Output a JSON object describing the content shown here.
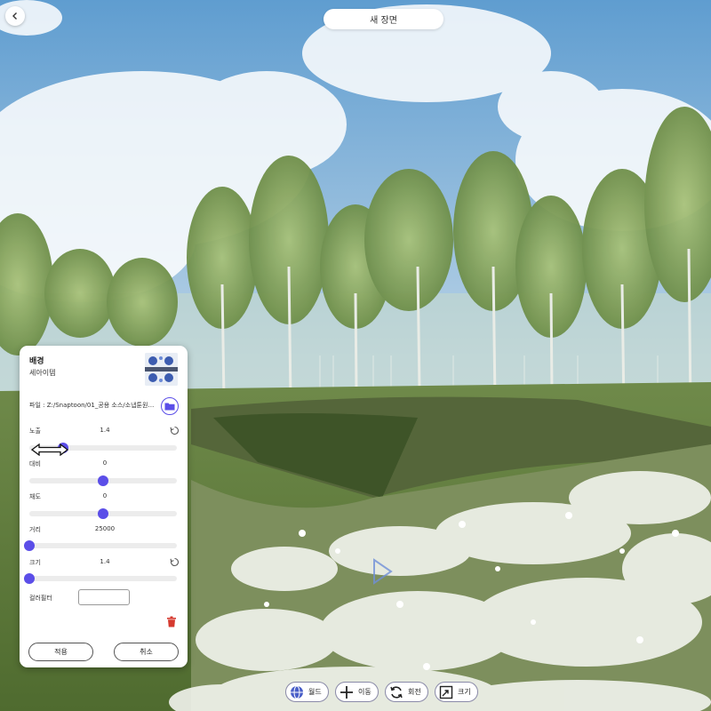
{
  "header": {
    "title": "새 장면"
  },
  "panel": {
    "title": "배경",
    "subtitle": "세아이템",
    "file_label": "파일 : Z:/Snaptoon/01_공용 소스/소냅툰원…",
    "sliders": [
      {
        "label": "노출",
        "value": "1.4",
        "fraction": 0.23,
        "has_reset": true
      },
      {
        "label": "대비",
        "value": "0",
        "fraction": 0.5,
        "has_reset": false
      },
      {
        "label": "채도",
        "value": "0",
        "fraction": 0.5,
        "has_reset": false
      },
      {
        "label": "거리",
        "value": "25000",
        "fraction": 0.0,
        "has_reset": false
      },
      {
        "label": "크기",
        "value": "1.4",
        "fraction": 0.0,
        "has_reset": true
      }
    ],
    "color_filter_label": "컬러필터",
    "apply_label": "적용",
    "cancel_label": "취소"
  },
  "toolbar": [
    {
      "label": "월드",
      "icon": "globe-icon"
    },
    {
      "label": "이동",
      "icon": "move-icon"
    },
    {
      "label": "회전",
      "icon": "rotate-icon"
    },
    {
      "label": "크기",
      "icon": "scale-icon"
    }
  ],
  "colors": {
    "accent": "#5b4ee8",
    "delete": "#d63a2f"
  }
}
